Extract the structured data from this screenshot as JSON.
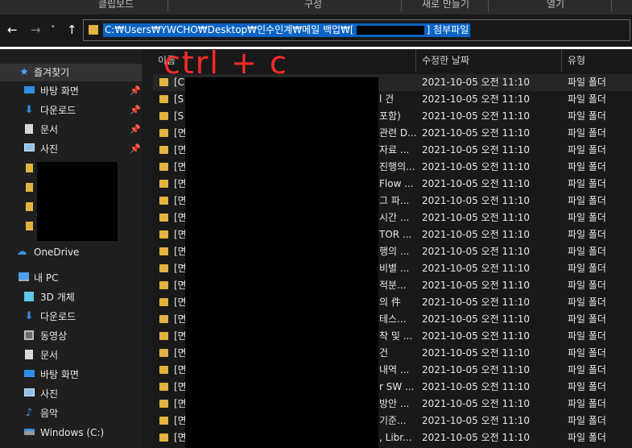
{
  "ribbon": {
    "clipboard": "클립보드",
    "organize": "구성",
    "new": "새로 만들기",
    "open": "열기"
  },
  "nav": {
    "back": "←",
    "forward": "→",
    "recent": "˅",
    "up": "↑"
  },
  "address": {
    "path_prefix": "C:₩Users₩YWCHO₩Desktop₩인수인계₩메일 백업₩[",
    "path_suffix": "] 첨부파일"
  },
  "annotation": "ctrl + c",
  "sidebar": {
    "items": [
      {
        "label": "즐겨찾기",
        "icon": "star-icon",
        "pinned": false
      },
      {
        "label": "바탕 화면",
        "icon": "desktop-icon",
        "pinned": true
      },
      {
        "label": "다운로드",
        "icon": "download-icon",
        "pinned": true
      },
      {
        "label": "문서",
        "icon": "document-icon",
        "pinned": true
      },
      {
        "label": "사진",
        "icon": "picture-icon",
        "pinned": true
      },
      {
        "label": "OneDrive",
        "icon": "cloud-icon",
        "pinned": false
      },
      {
        "label": "내 PC",
        "icon": "pc-icon",
        "pinned": false
      },
      {
        "label": "3D 개체",
        "icon": "cube-icon",
        "pinned": false
      },
      {
        "label": "다운로드",
        "icon": "download-icon",
        "pinned": false
      },
      {
        "label": "동영상",
        "icon": "video-icon",
        "pinned": false
      },
      {
        "label": "문서",
        "icon": "document-icon",
        "pinned": false
      },
      {
        "label": "바탕 화면",
        "icon": "desktop-icon",
        "pinned": false
      },
      {
        "label": "사진",
        "icon": "picture-icon",
        "pinned": false
      },
      {
        "label": "음악",
        "icon": "music-icon",
        "pinned": false
      },
      {
        "label": "Windows (C:)",
        "icon": "drive-icon",
        "pinned": false
      }
    ]
  },
  "columns": {
    "name": "이름",
    "modified": "수정한 날짜",
    "type": "유형"
  },
  "rows": [
    {
      "name": "[C",
      "tail": "",
      "date": "2021-10-05 오전 11:10",
      "type": "파일 폴더"
    },
    {
      "name": "[S",
      "tail": "l 건",
      "date": "2021-10-05 오전 11:10",
      "type": "파일 폴더"
    },
    {
      "name": "[S",
      "tail": "포함)",
      "date": "2021-10-05 오전 11:10",
      "type": "파일 폴더"
    },
    {
      "name": "[면",
      "tail": "관련 D...",
      "date": "2021-10-05 오전 11:10",
      "type": "파일 폴더"
    },
    {
      "name": "[면",
      "tail": "자료 ...",
      "date": "2021-10-05 오전 11:10",
      "type": "파일 폴더"
    },
    {
      "name": "[면",
      "tail": "진행의...",
      "date": "2021-10-05 오전 11:10",
      "type": "파일 폴더"
    },
    {
      "name": "[면",
      "tail": "Flow ...",
      "date": "2021-10-05 오전 11:10",
      "type": "파일 폴더"
    },
    {
      "name": "[면",
      "tail": "그 파...",
      "date": "2021-10-05 오전 11:10",
      "type": "파일 폴더"
    },
    {
      "name": "[면",
      "tail": "시간 ...",
      "date": "2021-10-05 오전 11:10",
      "type": "파일 폴더"
    },
    {
      "name": "[면",
      "tail": "TOR ...",
      "date": "2021-10-05 오전 11:10",
      "type": "파일 폴더"
    },
    {
      "name": "[면",
      "tail": "행의 ...",
      "date": "2021-10-05 오전 11:10",
      "type": "파일 폴더"
    },
    {
      "name": "[면",
      "tail": "비별 ...",
      "date": "2021-10-05 오전 11:10",
      "type": "파일 폴더"
    },
    {
      "name": "[면",
      "tail": "적분...",
      "date": "2021-10-05 오전 11:10",
      "type": "파일 폴더"
    },
    {
      "name": "[면",
      "tail": "의 件",
      "date": "2021-10-05 오전 11:10",
      "type": "파일 폴더"
    },
    {
      "name": "[면",
      "tail": "테스...",
      "date": "2021-10-05 오전 11:10",
      "type": "파일 폴더"
    },
    {
      "name": "[면",
      "tail": "착 및 ...",
      "date": "2021-10-05 오전 11:10",
      "type": "파일 폴더"
    },
    {
      "name": "[면",
      "tail": "건",
      "date": "2021-10-05 오전 11:10",
      "type": "파일 폴더"
    },
    {
      "name": "[면",
      "tail": "내역 ...",
      "date": "2021-10-05 오전 11:10",
      "type": "파일 폴더"
    },
    {
      "name": "[면",
      "tail": "r SW ...",
      "date": "2021-10-05 오전 11:10",
      "type": "파일 폴더"
    },
    {
      "name": "[면",
      "tail": "방안 ...",
      "date": "2021-10-05 오전 11:10",
      "type": "파일 폴더"
    },
    {
      "name": "[면",
      "tail": "기준...",
      "date": "2021-10-05 오전 11:10",
      "type": "파일 폴더"
    },
    {
      "name": "[면",
      "tail": ", Libr...",
      "date": "2021-10-05 오전 11:10",
      "type": "파일 폴더"
    }
  ]
}
